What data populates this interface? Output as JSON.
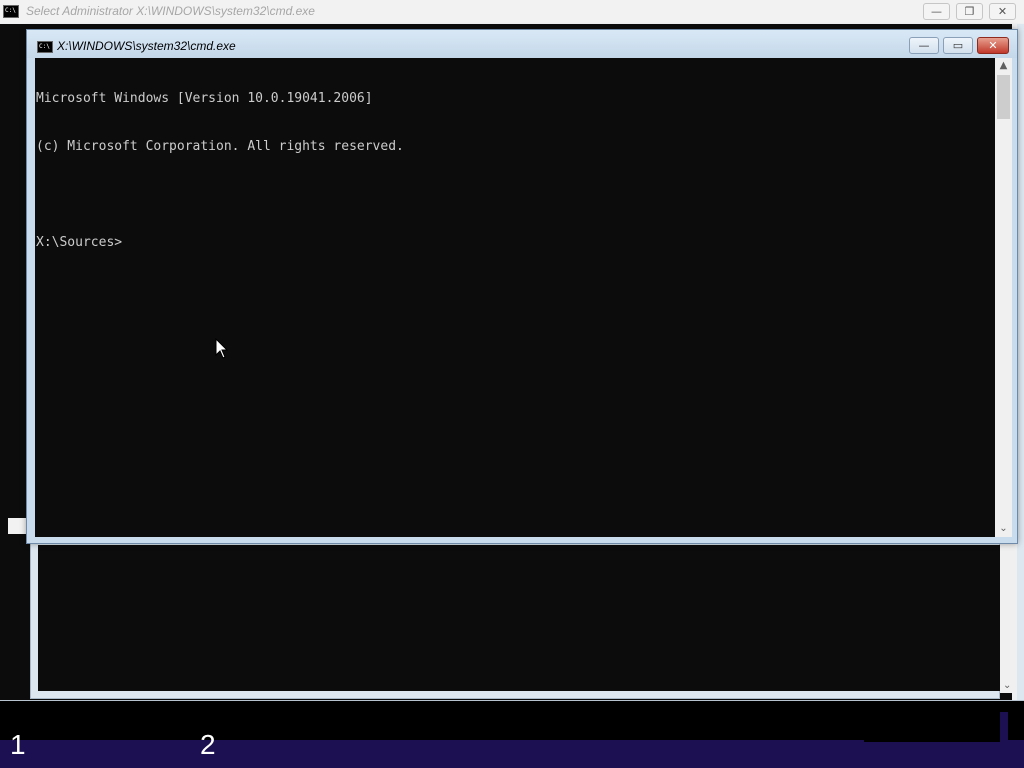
{
  "background_window": {
    "title": "Select Administrator X:\\WINDOWS\\system32\\cmd.exe",
    "icon": "cmd-icon",
    "controls": {
      "minimize": "—",
      "restore": "❐",
      "close": "✕"
    }
  },
  "foreground_window": {
    "title": "X:\\WINDOWS\\system32\\cmd.exe",
    "icon": "cmd-icon",
    "controls": {
      "minimize": "—",
      "maximize": "▭",
      "close": "✕"
    },
    "console_lines": [
      "Microsoft Windows [Version 10.0.19041.2006]",
      "(c) Microsoft Corporation. All rights reserved.",
      "",
      "X:\\Sources>"
    ]
  },
  "scrollbar": {
    "up_arrow": "▲",
    "down_arrow": "⌄"
  },
  "bottom_labels": [
    "1",
    "2"
  ],
  "colors": {
    "console_bg": "#0c0c0c",
    "console_fg": "#cccccc",
    "bottom_band": "#1c0f52"
  }
}
